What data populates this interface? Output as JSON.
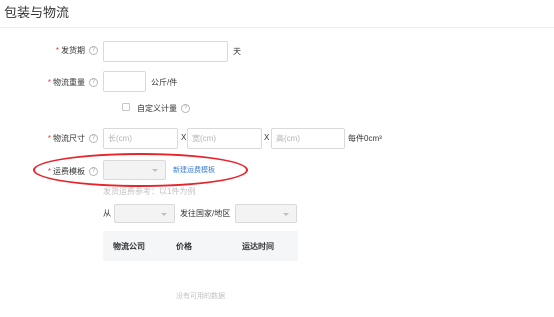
{
  "section": {
    "title": "包装与物流"
  },
  "shipping_days": {
    "label": "发货期",
    "value": "",
    "unit": "天"
  },
  "weight": {
    "label": "物流重量",
    "value": "",
    "unit": "公斤/件"
  },
  "custom_weight": {
    "label": "自定义计量",
    "checked": false
  },
  "dimensions": {
    "label": "物流尺寸",
    "length_placeholder": "长(cm)",
    "width_placeholder": "宽(cm)",
    "height_placeholder": "高(cm)",
    "separator": "X",
    "volume_text": "每件0cm³"
  },
  "template": {
    "label": "运费模板",
    "selected": "",
    "new_link": "新建运费模板"
  },
  "shipping_hint": "发货运费参考：以1件为例",
  "route": {
    "from_label": "从",
    "from_value": "",
    "to_label": "发往国家/地区",
    "to_value": ""
  },
  "table": {
    "headers": [
      "物流公司",
      "价格",
      "运达时间"
    ],
    "empty_text": "没有可用的数据"
  },
  "required_mark": "*",
  "help_glyph": "?",
  "colors": {
    "required": "#e4393c",
    "link": "#3a7bd5",
    "annotation": "#e8232a"
  }
}
